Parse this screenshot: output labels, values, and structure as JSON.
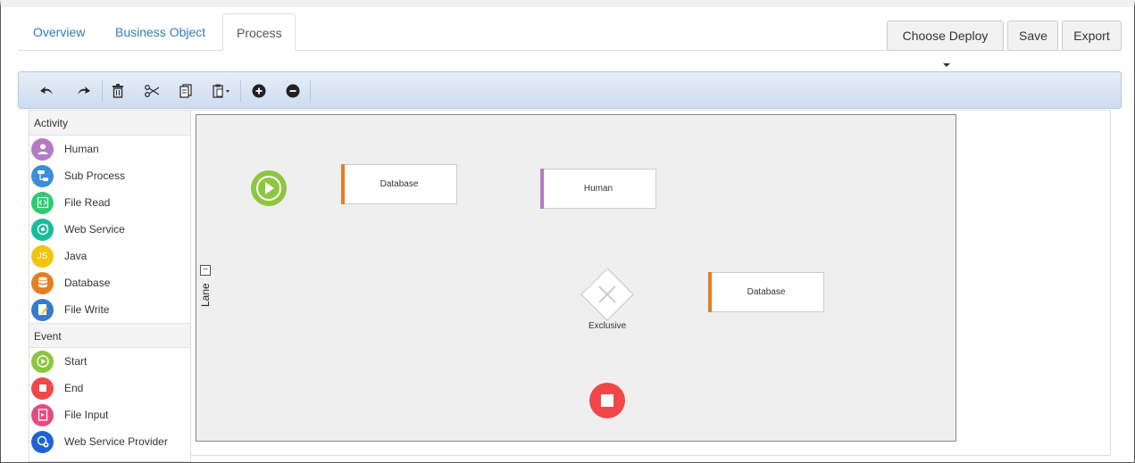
{
  "tabs": [
    {
      "label": "Overview"
    },
    {
      "label": "Business Object"
    },
    {
      "label": "Process"
    }
  ],
  "actions": {
    "deploy_label": "Choose Deploy",
    "save_label": "Save",
    "export_label": "Export"
  },
  "toolbar": [
    "undo-icon",
    "redo-icon",
    "delete-icon",
    "cut-icon",
    "copy-icon",
    "paste-icon",
    "zoom-in-icon",
    "zoom-out-icon"
  ],
  "palette": {
    "activity_header": "Activity",
    "activity": [
      {
        "label": "Human",
        "icon": "human-icon",
        "color": "#b57bc4"
      },
      {
        "label": "Sub Process",
        "icon": "subprocess-icon",
        "color": "#3a8fd6"
      },
      {
        "label": "File Read",
        "icon": "file-read-icon",
        "color": "#2ecc71"
      },
      {
        "label": "Web Service",
        "icon": "web-service-icon",
        "color": "#1abc9c"
      },
      {
        "label": "Java",
        "icon": "java-icon",
        "color": "#f1c40f"
      },
      {
        "label": "Database",
        "icon": "database-icon",
        "color": "#e67e22"
      },
      {
        "label": "File Write",
        "icon": "file-write-icon",
        "color": "#3a7bc8"
      }
    ],
    "event_header": "Event",
    "event": [
      {
        "label": "Start",
        "icon": "start-icon",
        "color": "#8dc63f"
      },
      {
        "label": "End",
        "icon": "end-icon",
        "color": "#f04848"
      },
      {
        "label": "File Input",
        "icon": "file-input-icon",
        "color": "#e84a7f"
      },
      {
        "label": "Web Service Provider",
        "icon": "web-service-provider-icon",
        "color": "#1f62d6"
      }
    ]
  },
  "diagram": {
    "lane_label": "Lane",
    "collapse_symbol": "−",
    "task_database_1": "Database",
    "task_human": "Human",
    "task_database_2": "Database",
    "gateway_label": "Exclusive",
    "colors": {
      "database": "#e67e22",
      "human": "#b57bc4",
      "start": "#8dc63f",
      "end": "#f04848"
    }
  }
}
